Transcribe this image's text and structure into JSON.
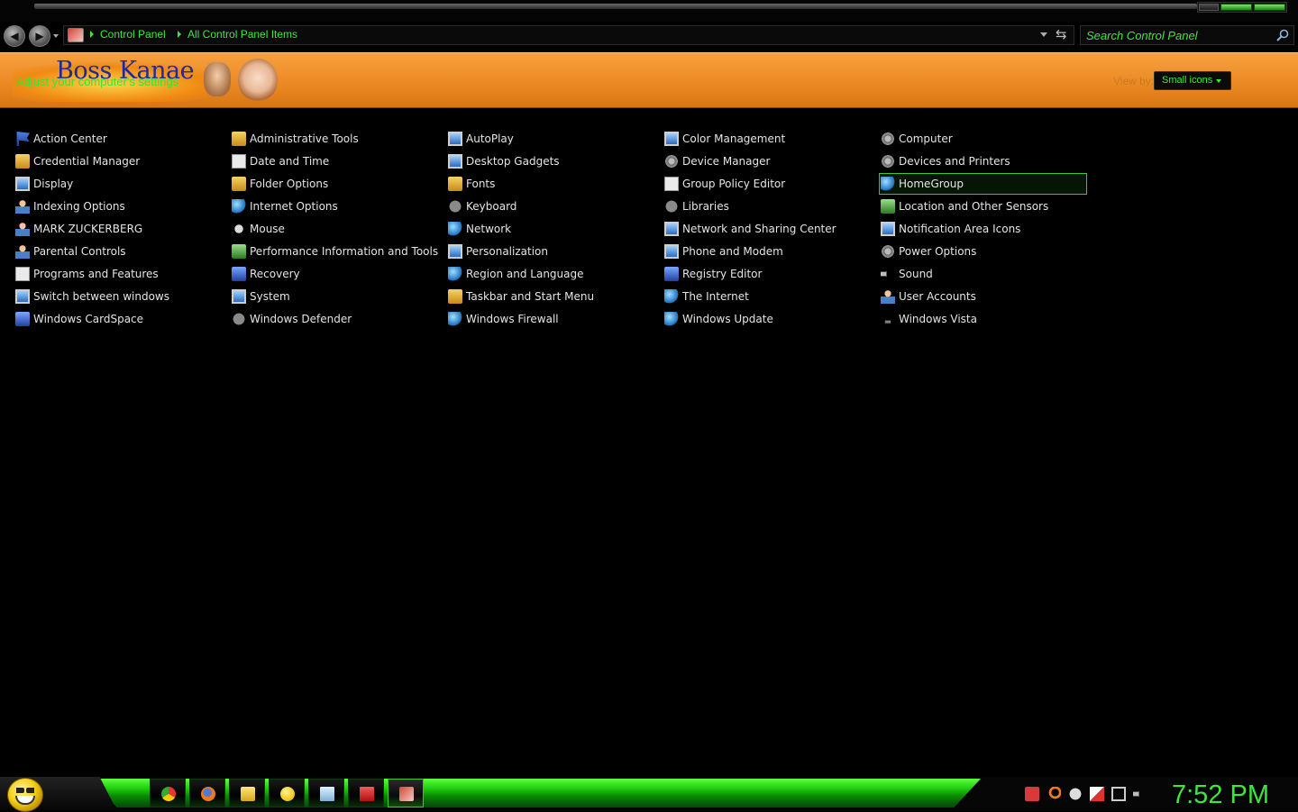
{
  "window": {
    "breadcrumbs": [
      "Control Panel",
      "All Control Panel Items"
    ],
    "search": {
      "placeholder": "Search Control Panel"
    }
  },
  "header": {
    "brand_name": "Boss Kanae",
    "subtitle": "Adjust your computer's settings",
    "view_by_label": "View by:",
    "view_by_value": "Small icons"
  },
  "items": [
    [
      "Action Center",
      "Credential Manager",
      "Display",
      "Indexing Options",
      "MARK ZUCKERBERG",
      "Parental Controls",
      "Programs and Features",
      "Switch between windows",
      "Windows CardSpace"
    ],
    [
      "Administrative Tools",
      "Date and Time",
      "Folder Options",
      "Internet Options",
      "Mouse",
      "Performance Information and Tools",
      "Recovery",
      "System",
      "Windows Defender"
    ],
    [
      "AutoPlay",
      "Desktop Gadgets",
      "Fonts",
      "Keyboard",
      "Network",
      "Personalization",
      "Region and Language",
      "Taskbar and Start Menu",
      "Windows Firewall"
    ],
    [
      "Color Management",
      "Device Manager",
      "Group Policy Editor",
      "Libraries",
      "Network and Sharing Center",
      "Phone and Modem",
      "Registry Editor",
      "The Internet",
      "Windows Update"
    ],
    [
      "Computer",
      "Devices and Printers",
      "HomeGroup",
      "Location and Other Sensors",
      "Notification Area Icons",
      "Power Options",
      "Sound",
      "User Accounts",
      "Windows Vista"
    ]
  ],
  "selected_item": "HomeGroup",
  "taskbar": {
    "apps": [
      "chrome-icon",
      "firefox-icon",
      "folder-icon",
      "messenger-icon",
      "notepad-icon",
      "media-icon",
      "control-panel-icon"
    ],
    "clock": "7:52 PM"
  },
  "colors": {
    "accent": "#39e83a",
    "band": "#ec8a24"
  }
}
